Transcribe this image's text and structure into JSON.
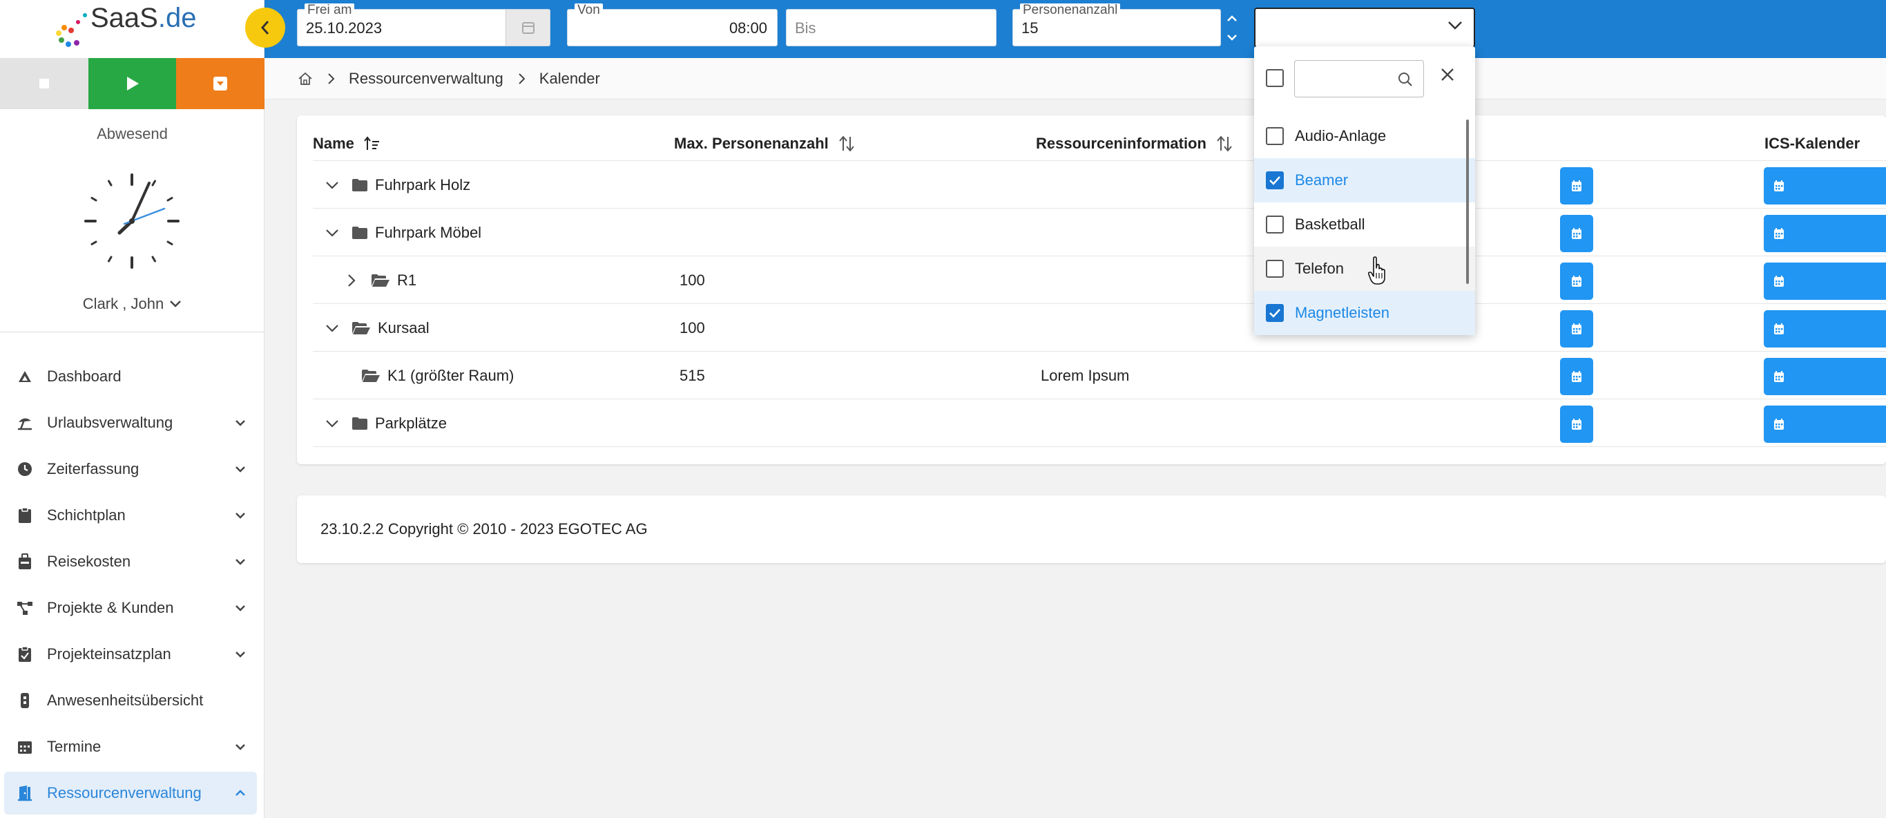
{
  "logo": {
    "name": "SaaS",
    "tld": ".de"
  },
  "sidebar": {
    "status": "Abwesend",
    "user": "Clark , John",
    "nav": [
      {
        "label": "Dashboard",
        "icon": "dashboard-icon",
        "expandable": false
      },
      {
        "label": "Urlaubsverwaltung",
        "icon": "beach-umbrella-icon",
        "expandable": true
      },
      {
        "label": "Zeiterfassung",
        "icon": "clock-icon",
        "expandable": true
      },
      {
        "label": "Schichtplan",
        "icon": "clipboard-icon",
        "expandable": true
      },
      {
        "label": "Reisekosten",
        "icon": "suitcase-icon",
        "expandable": true
      },
      {
        "label": "Projekte & Kunden",
        "icon": "network-icon",
        "expandable": true
      },
      {
        "label": "Projekteinsatzplan",
        "icon": "clipboard-check-icon",
        "expandable": true
      },
      {
        "label": "Anwesenheitsübersicht",
        "icon": "badge-icon",
        "expandable": false
      },
      {
        "label": "Termine",
        "icon": "calendar-icon",
        "expandable": true
      },
      {
        "label": "Ressourcenverwaltung",
        "icon": "door-icon",
        "expandable": true,
        "active": true
      }
    ]
  },
  "filters": {
    "date": {
      "label": "Frei am",
      "value": "25.10.2023"
    },
    "from": {
      "label": "Von",
      "value": "08:00"
    },
    "to": {
      "placeholder": "Bis"
    },
    "persons": {
      "label": "Personenanzahl",
      "value": "15"
    }
  },
  "breadcrumb": {
    "items": [
      "Ressourcenverwaltung",
      "Kalender"
    ]
  },
  "table": {
    "headers": {
      "name": "Name",
      "max": "Max. Personenanzahl",
      "info": "Ressourceninformation",
      "ics": "ICS-Kalender"
    },
    "rows": [
      {
        "name": "Fuhrpark Holz",
        "max": "",
        "info": "",
        "level": 0,
        "toggle": "down",
        "folder": "closed"
      },
      {
        "name": "Fuhrpark Möbel",
        "max": "",
        "info": "",
        "level": 0,
        "toggle": "down",
        "folder": "closed"
      },
      {
        "name": "R1",
        "max": "100",
        "info": "",
        "level": 1,
        "toggle": "right",
        "folder": "open"
      },
      {
        "name": "Kursaal",
        "max": "100",
        "info": "",
        "level": 0,
        "toggle": "down",
        "folder": "open"
      },
      {
        "name": "K1 (größter Raum)",
        "max": "515",
        "info": "Lorem Ipsum",
        "level": 1,
        "toggle": "none",
        "folder": "open"
      },
      {
        "name": "Parkplätze",
        "max": "",
        "info": "",
        "level": 0,
        "toggle": "down",
        "folder": "closed"
      }
    ]
  },
  "footer": {
    "text": "23.10.2.2 Copyright © 2010 - 2023 EGOTEC AG"
  },
  "equipment_dropdown": {
    "options": [
      {
        "label": "Audio-Anlage",
        "checked": false
      },
      {
        "label": "Beamer",
        "checked": true
      },
      {
        "label": "Basketball",
        "checked": false
      },
      {
        "label": "Telefon",
        "checked": false,
        "hover": true
      },
      {
        "label": "Magnetleisten",
        "checked": true
      }
    ]
  },
  "colors": {
    "topbar": "#1d7fd1",
    "accent": "#2196f3",
    "play": "#27a844",
    "pause": "#ef7d1a",
    "collapse": "#f6c90e"
  }
}
